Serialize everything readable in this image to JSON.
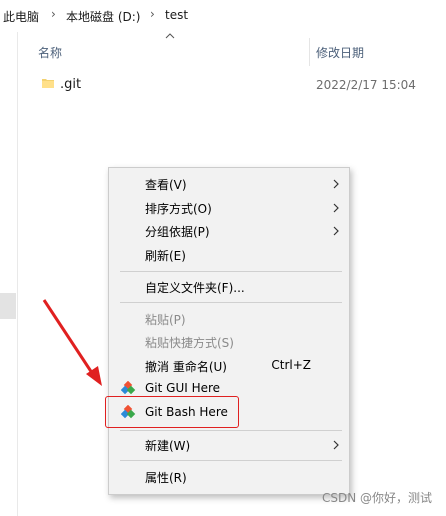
{
  "breadcrumb": {
    "item1": "此电脑",
    "item2": "本地磁盘 (D:)",
    "item3": "test"
  },
  "columns": {
    "name": "名称",
    "date": "修改日期"
  },
  "file": {
    "name": ".git",
    "date": "2022/2/17 15:04"
  },
  "menu": {
    "view": "查看(V)",
    "sort": "排序方式(O)",
    "group": "分组依据(P)",
    "refresh": "刷新(E)",
    "customize": "自定义文件夹(F)...",
    "paste": "粘贴(P)",
    "paste_shortcut": "粘贴快捷方式(S)",
    "undo": "撤消 重命名(U)",
    "undo_shortcut": "Ctrl+Z",
    "git_gui": "Git GUI Here",
    "git_bash": "Git Bash Here",
    "new": "新建(W)",
    "properties": "属性(R)"
  },
  "watermark": "CSDN @你好，测试",
  "colors": {
    "highlight_box": "#e02020",
    "arrow": "#e02020",
    "git_orange": "#f05133",
    "git_blue": "#2b8ad8",
    "git_green": "#3aa84b"
  },
  "icons": [
    "chevron-right-icon",
    "folder-icon",
    "git-gui-icon",
    "git-bash-icon",
    "sort-caret-icon",
    "submenu-arrow-icon"
  ]
}
